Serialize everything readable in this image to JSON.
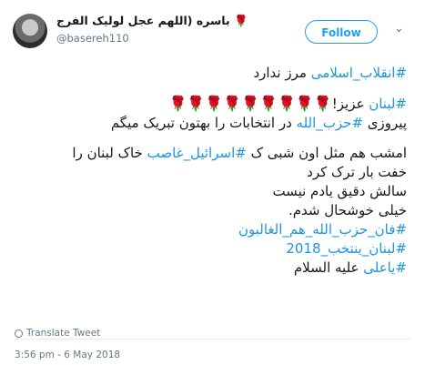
{
  "user": {
    "display_name": "باسره (اللهم عجل لولیک الفرج",
    "rose": "🌹",
    "handle": "@basereh110"
  },
  "follow_label": "Follow",
  "tweet": {
    "line1_tag": "#انقلاب_اسلامی",
    "line1_text": " مرز ندارد",
    "line2_tag": "#لبنان",
    "line2_text": " عزیز!",
    "line2_roses": "🌹🌹🌹🌹🌹🌹🌹🌹🌹",
    "line3_pre": "پیروزی ",
    "line3_tag": "#حزب_الله",
    "line3_post": " در انتخابات را بهتون تبریک میگم",
    "line4_pre": "امشب هم مثل اون شبی ک ",
    "line4_tag": "#اسرائیل_غاصب",
    "line4_post": " خاک لبنان را",
    "line5": "خفت بار ترک کرد",
    "line6": "سالش دقیق یادم نیست",
    "line7": "خیلی خوشحال شدم.",
    "tag1": "#فان_حزب_الله_هم_الغالبون",
    "tag2": "#لبنان_ينتخب_2018",
    "line10_tag": "#یاعلی",
    "line10_text": " علیه السلام"
  },
  "translate_label": "Translate Tweet",
  "timestamp": "3:56 pm - 6 May 2018",
  "colors": {
    "accent": "#1da1f2",
    "link": "#1b95e0",
    "rose": "#c0152a"
  }
}
